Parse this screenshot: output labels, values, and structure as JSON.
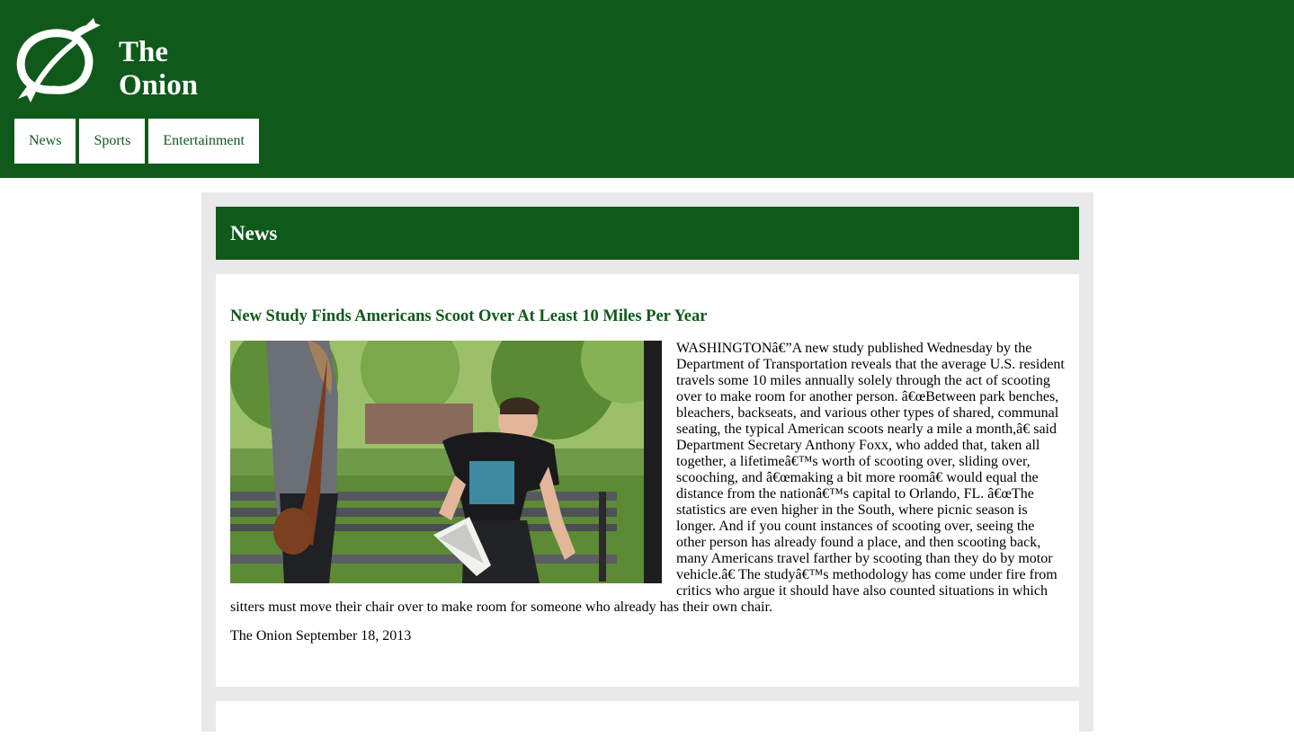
{
  "header": {
    "brand_line1": "The",
    "brand_line2": "Onion",
    "logo_icon": "onion-logo-icon",
    "background_color": "#0f5a1a"
  },
  "nav": {
    "items": [
      {
        "label": "News"
      },
      {
        "label": "Sports"
      },
      {
        "label": "Entertainment"
      }
    ]
  },
  "section": {
    "title": "News"
  },
  "article": {
    "title": "New Study Finds Americans Scoot Over At Least 10 Miles Per Year",
    "image_alt": "Woman standing next to a man scooting over on a park bench holding a newspaper",
    "body": "WASHINGTONâ€”A new study published Wednesday by the Department of Transportation reveals that the average U.S. resident travels some 10 miles annually solely through the act of scooting over to make room for another person. â€œBetween park benches, bleachers, backseats, and various other types of shared, communal seating, the typical American scoots nearly a mile a month,â€ said Department Secretary Anthony Foxx, who added that, taken all together, a lifetimeâ€™s worth of scooting over, sliding over, scooching, and â€œmaking a bit more roomâ€ would equal the distance from the nationâ€™s capital to Orlando, FL. â€œThe statistics are even higher in the South, where picnic season is longer. And if you count instances of scooting over, seeing the other person has already found a place, and then scooting back, many Americans travel farther by scooting than they do by motor vehicle.â€ The studyâ€™s methodology has come under fire from critics who argue it should have also counted situations in which sitters must move their chair over to make room for someone who already has their own chair.",
    "byline": "The Onion September 18, 2013"
  },
  "colors": {
    "brand_green": "#0f5a1a",
    "panel_gray": "#e8e9e8"
  }
}
